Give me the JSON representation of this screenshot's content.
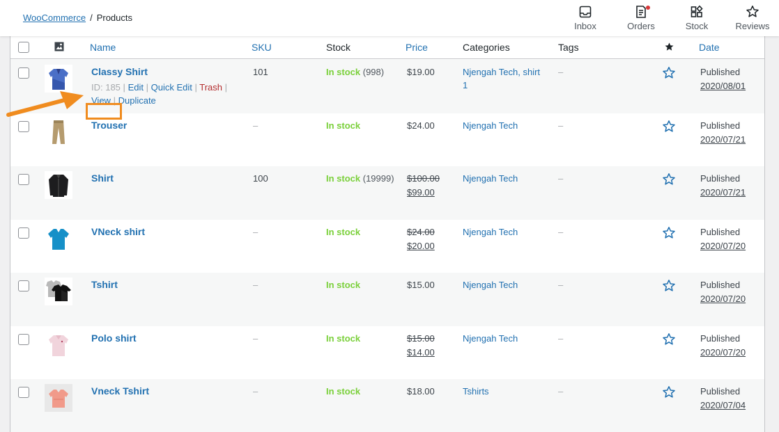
{
  "breadcrumb": {
    "root": "WooCommerce",
    "separator": "/",
    "current": "Products"
  },
  "topnav": [
    {
      "label": "Inbox",
      "icon": "inbox-icon"
    },
    {
      "label": "Orders",
      "icon": "orders-icon"
    },
    {
      "label": "Stock",
      "icon": "stock-icon"
    },
    {
      "label": "Reviews",
      "icon": "reviews-icon"
    }
  ],
  "table": {
    "headers": {
      "image": "image-icon",
      "name": "Name",
      "sku": "SKU",
      "stock": "Stock",
      "price": "Price",
      "categories": "Categories",
      "tags": "Tags",
      "featured": "featured-star-icon",
      "date": "Date"
    },
    "rows": [
      {
        "name": "Classy Shirt",
        "sku": "101",
        "stock": "In stock",
        "qty": "(998)",
        "price": "$19.00",
        "price_old": "",
        "categories": "Njengah Tech, shirt",
        "categories_2": "1",
        "tags": "–",
        "status": "Published",
        "date": "2020/08/01",
        "actions": {
          "id": "ID: 185",
          "edit": "Edit",
          "quick_edit": "Quick Edit",
          "trash": "Trash",
          "view": "View",
          "duplicate": "Duplicate",
          "sep": "|"
        }
      },
      {
        "name": "Trouser",
        "sku": "–",
        "stock": "In stock",
        "qty": "",
        "price": "$24.00",
        "price_old": "",
        "categories": "Njengah Tech",
        "tags": "–",
        "status": "Published",
        "date": "2020/07/21"
      },
      {
        "name": "Shirt",
        "sku": "100",
        "stock": "In stock",
        "qty": "(19999)",
        "price": "$99.00",
        "price_old": "$100.00",
        "categories": "Njengah Tech",
        "tags": "–",
        "status": "Published",
        "date": "2020/07/21"
      },
      {
        "name": "VNeck shirt",
        "sku": "–",
        "stock": "In stock",
        "qty": "",
        "price": "$20.00",
        "price_old": "$24.00",
        "categories": "Njengah Tech",
        "tags": "–",
        "status": "Published",
        "date": "2020/07/20"
      },
      {
        "name": "Tshirt",
        "sku": "–",
        "stock": "In stock",
        "qty": "",
        "price": "$15.00",
        "price_old": "",
        "categories": "Njengah Tech",
        "tags": "–",
        "status": "Published",
        "date": "2020/07/20"
      },
      {
        "name": "Polo shirt",
        "sku": "–",
        "stock": "In stock",
        "qty": "",
        "price": "$14.00",
        "price_old": "$15.00",
        "categories": "Njengah Tech",
        "tags": "–",
        "status": "Published",
        "date": "2020/07/20"
      },
      {
        "name": "Vneck Tshirt",
        "sku": "–",
        "stock": "In stock",
        "qty": "",
        "price": "$18.00",
        "price_old": "",
        "categories": "Tshirts",
        "tags": "–",
        "status": "Published",
        "date": "2020/07/04"
      }
    ]
  },
  "annotation": {
    "color": "#f08c1f",
    "arrow": "arrow-annotation"
  },
  "colors": {
    "link": "#2271b1",
    "in_stock": "#7ad03a",
    "trash": "#b32d2e",
    "badge": "#d63638"
  }
}
